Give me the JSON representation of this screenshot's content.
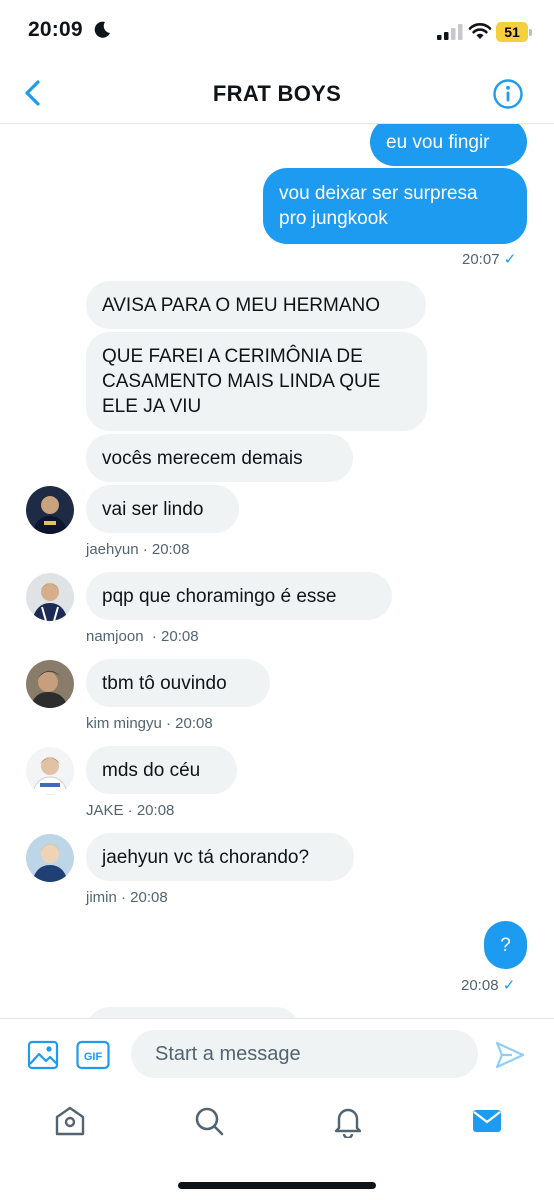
{
  "status_bar": {
    "time": "20:09",
    "battery": "51"
  },
  "header": {
    "title": "FRAT BOYS"
  },
  "messages": {
    "out1": "eu vou fingir",
    "out2_line1": "vou deixar ser surpresa",
    "out2_line2": "pro jungkook",
    "out2_time": "20:07",
    "in1": "AVISA PARA O MEU HERMANO",
    "in2_line1": "QUE FAREI A CERIMÔNIA DE",
    "in2_line2": "CASAMENTO MAIS LINDA QUE",
    "in2_line3": "ELE JA VIU",
    "in3": "vocês merecem demais",
    "in4": "vai ser lindo",
    "in4_meta": "jaehyun · 20:08",
    "in5": "pqp que choramingo é esse",
    "in5_meta": "namjoon  · 20:08",
    "in6": "tbm tô ouvindo",
    "in6_meta": "kim mingyu · 20:08",
    "in7": "mds do céu",
    "in7_meta": "JAKE · 20:08",
    "in8": "jaehyun vc tá chorando?",
    "in8_meta": "jimin · 20:08",
    "out3": "?",
    "out3_time": "20:08",
    "check": "✓"
  },
  "composer": {
    "placeholder": "Start a message",
    "gif_label": "GIF"
  },
  "colors": {
    "accent": "#1d9bf0",
    "incoming_bubble": "#eff3f4",
    "meta_text": "#536471",
    "battery": "#f4d03f"
  }
}
